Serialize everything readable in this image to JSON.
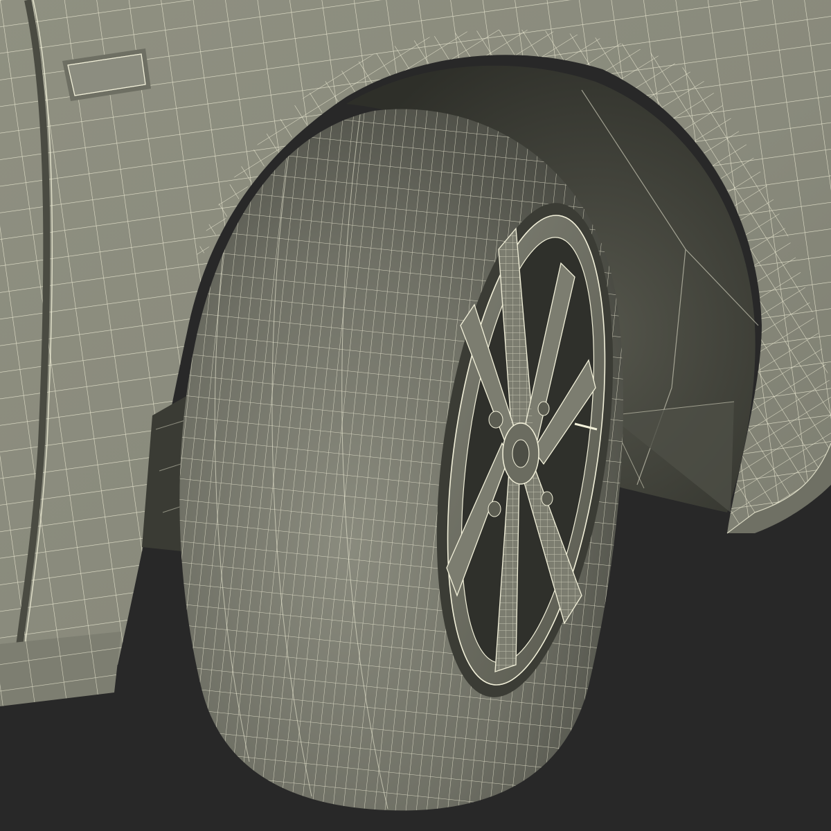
{
  "scene": {
    "subject": "car-front-wheel-wireframe-render",
    "colors": {
      "background": "#282828",
      "body_light": "#8f9081",
      "body_mid": "#7e7f71",
      "body_dark": "#5d5e53",
      "wheel_well": "#3c3d36",
      "tire_light": "#85867a",
      "tire_dark": "#4b4c44",
      "rim": "#6f7064",
      "rim_shadow": "#2f302b",
      "wire": "#f3f1da"
    }
  }
}
